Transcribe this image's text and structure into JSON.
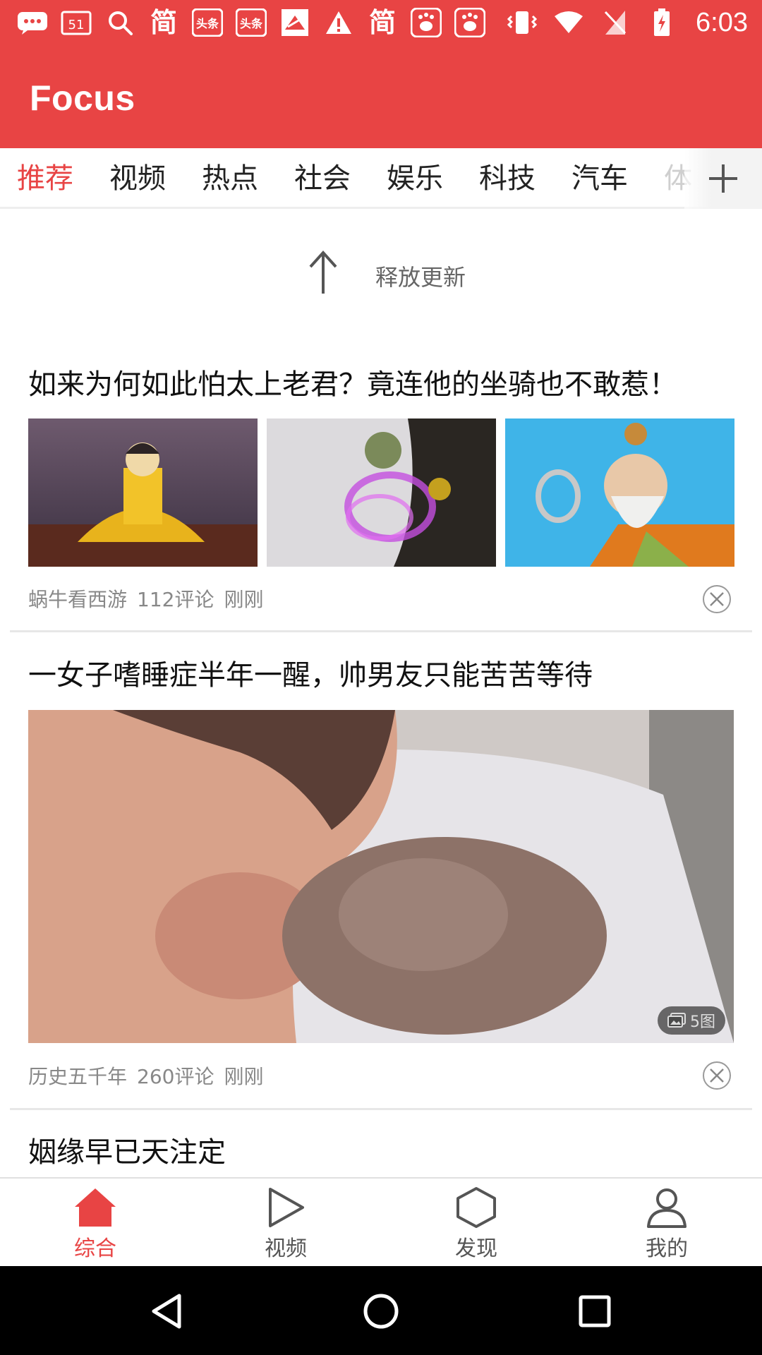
{
  "status_bar": {
    "time": "6:03",
    "notification_icons": [
      "chat-icon",
      "calendar-51-icon",
      "search-icon",
      "jian-icon",
      "toutiao-icon",
      "toutiao-icon",
      "bird-app-icon",
      "warning-icon",
      "jian-icon",
      "baidu-icon",
      "baidu-icon"
    ],
    "status_icons": [
      "vibrate-icon",
      "wifi-icon",
      "no-sim-icon",
      "battery-charging-icon"
    ],
    "calendar_day": "51",
    "jian_char": "简",
    "toutiao_text": "头条"
  },
  "app": {
    "title": "Focus",
    "accent_color": "#e84444"
  },
  "tabs": [
    {
      "label": "推荐",
      "active": true
    },
    {
      "label": "视频"
    },
    {
      "label": "热点"
    },
    {
      "label": "社会"
    },
    {
      "label": "娱乐"
    },
    {
      "label": "科技"
    },
    {
      "label": "汽车"
    },
    {
      "label": "体"
    }
  ],
  "refresh": {
    "text": "释放更新"
  },
  "articles": [
    {
      "title": "如来为何如此怕太上老君？竟连他的坐骑也不敢惹！",
      "source": "蜗牛看西游",
      "comments": "112评论",
      "time": "刚刚"
    },
    {
      "title": "一女子嗜睡症半年一醒，帅男友只能苦苦等待",
      "source": "历史五千年",
      "comments": "260评论",
      "time": "刚刚",
      "image_count": "5图"
    },
    {
      "title": "姻缘早已天注定"
    }
  ],
  "bottom_nav": [
    {
      "label": "综合",
      "icon": "home-icon",
      "active": true
    },
    {
      "label": "视频",
      "icon": "play-icon"
    },
    {
      "label": "发现",
      "icon": "hexagon-icon"
    },
    {
      "label": "我的",
      "icon": "person-icon"
    }
  ]
}
